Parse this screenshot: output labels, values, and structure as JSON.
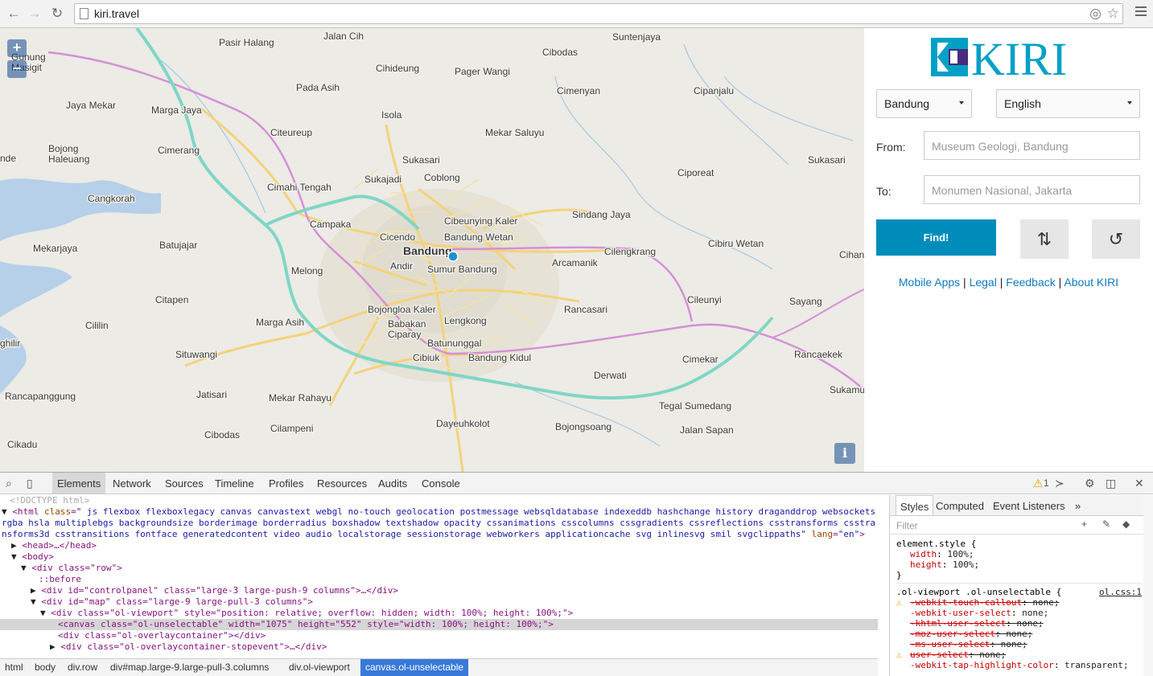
{
  "browser": {
    "url": "kiri.travel"
  },
  "map": {
    "zoom_in": "+",
    "zoom_out": "−",
    "info": "i",
    "place_labels": [
      "Pasir Halang",
      "Cibodas",
      "Suntenjaya",
      "Gunung\nMasigit",
      "Cihideung",
      "Pager Wangi",
      "Pada Asih",
      "Cimenyan",
      "Cipanjalu",
      "Jaya Mekar",
      "Marga Jaya",
      "Isola",
      "Citeureup",
      "Mekar Saluyu",
      "Bojong\nHaleuang",
      "Cimerang",
      "Sukasari",
      "Sukasari",
      "Sukajadi",
      "Coblong",
      "Ciporeat",
      "Cimahi Tengah",
      "Cangkorah",
      "Sindang Jaya",
      "Cibeunying Kaler",
      "Campaka",
      "Bandung Wetan",
      "Cicendo",
      "Batujajar",
      "Mekarjaya",
      "Bandung",
      "Cilengkrang",
      "Cibiru Wetan",
      "Arcamanik",
      "Cihanj",
      "Andir",
      "Sumur Bandung",
      "Melong",
      "Citapen",
      "Cileunyi",
      "Sayang",
      "Bojongloa Kaler",
      "Rancasari",
      "Lengkong",
      "Marga Asih",
      "Cililin",
      "Babakan\nCiparay",
      "ghilir",
      "Batununggal",
      "Cimekar",
      "Situwangi",
      "Bandung Kidul",
      "Rancaekek",
      "Derwati",
      "Rancapanggung",
      "Jatisari",
      "Mekar Rahayu",
      "Tegal Sumedang",
      "Sukamu",
      "Dayeuhkolot",
      "Bojongsoang",
      "Cibodas",
      "Cilampeni",
      "Cikadu",
      "nde",
      "Jalan Cih",
      "Jalan Sapan",
      "Cibiuk"
    ]
  },
  "panel": {
    "logo_text": "KIRI",
    "city_select": "Bandung",
    "language_select": "English",
    "from_label": "From:",
    "from_placeholder": "Museum Geologi, Bandung",
    "to_label": "To:",
    "to_placeholder": "Monumen Nasional, Jakarta",
    "find_label": "Find!",
    "swap_icon": "⇅",
    "reset_icon": "↺",
    "links": [
      "Mobile Apps",
      "Legal",
      "Feedback",
      "About KIRI"
    ],
    "separator": " | "
  },
  "devtools": {
    "tabs": [
      "Elements",
      "Network",
      "Sources",
      "Timeline",
      "Profiles",
      "Resources",
      "Audits",
      "Console"
    ],
    "warning_count": "1",
    "dom": {
      "doctype": "<!DOCTYPE html>",
      "html_open": "<html",
      "html_class_attr": "class",
      "html_class_val": "\" js flexbox flexboxlegacy canvas canvastext webgl no-touch geolocation postmessage websqldatabase indexeddb hashchange history draganddrop websockets rgba hsla multiplebgs backgroundsize borderimage borderradius boxshadow textshadow opacity cssanimations csscolumns cssgradients cssreflections csstransforms csstransforms3d csstransitions fontface generatedcontent video audio localstorage sessionstorage webworkers applicationcache svg inlinesvg smil svgclippaths\"",
      "html_lang_attr": "lang",
      "html_lang_val": "\"en\"",
      "head": "<head>…</head>",
      "body": "<body>",
      "div_row": "<div class=\"row\">",
      "before": "::before",
      "controlpanel": "<div id=\"controlpanel\" class=\"large-3 large-push-9 columns\">…</div>",
      "map_div": "<div id=\"map\" class=\"large-9 large-pull-3 columns\">",
      "viewport": "<div class=\"ol-viewport\" style=\"position: relative; overflow: hidden; width: 100%; height: 100%;\">",
      "canvas": "<canvas class=\"ol-unselectable\" width=\"1075\" height=\"552\" style=\"width: 100%; height: 100%;\">",
      "overlay": "<div class=\"ol-overlaycontainer\"></div>",
      "overlay_stop": "<div class=\"ol-overlaycontainer-stopevent\">…</div>"
    },
    "breadcrumbs": [
      "html",
      "body",
      "div.row",
      "div#map.large-9.large-pull-3.columns",
      "div.ol-viewport",
      "canvas.ol-unselectable"
    ],
    "styles_tabs": [
      "Styles",
      "Computed",
      "Event Listeners",
      "»"
    ],
    "filter_placeholder": "Filter",
    "element_style_selector": "element.style {",
    "element_style_props": [
      {
        "name": "width",
        "value": "100%;"
      },
      {
        "name": "height",
        "value": "100%;"
      }
    ],
    "close_brace": "}",
    "rule_selector": ".ol-viewport .ol-unselectable {",
    "rule_source": "ol.css:1",
    "rule_props": [
      {
        "name": "-webkit-touch-callout",
        "value": "none;",
        "struck": true,
        "warn": true
      },
      {
        "name": "-webkit-user-select",
        "value": "none;",
        "struck": false,
        "warn": false
      },
      {
        "name": "-khtml-user-select",
        "value": "none;",
        "struck": true,
        "warn": false
      },
      {
        "name": "-moz-user-select",
        "value": "none;",
        "struck": true,
        "warn": false
      },
      {
        "name": "-ms-user-select",
        "value": "none;",
        "struck": true,
        "warn": false
      },
      {
        "name": "user-select",
        "value": "none;",
        "struck": true,
        "warn": true
      },
      {
        "name": "-webkit-tap-highlight-color",
        "value": "transparent;",
        "struck": false,
        "warn": false
      }
    ]
  },
  "colors": {
    "find_button": "#008cba",
    "link": "#0f7bc1",
    "logo_blue": "#00a0c6",
    "logo_purple": "#4a2a7e",
    "highway": "#7fd6c6",
    "route": "#d68fd6",
    "major_road": "#f5d27a"
  }
}
